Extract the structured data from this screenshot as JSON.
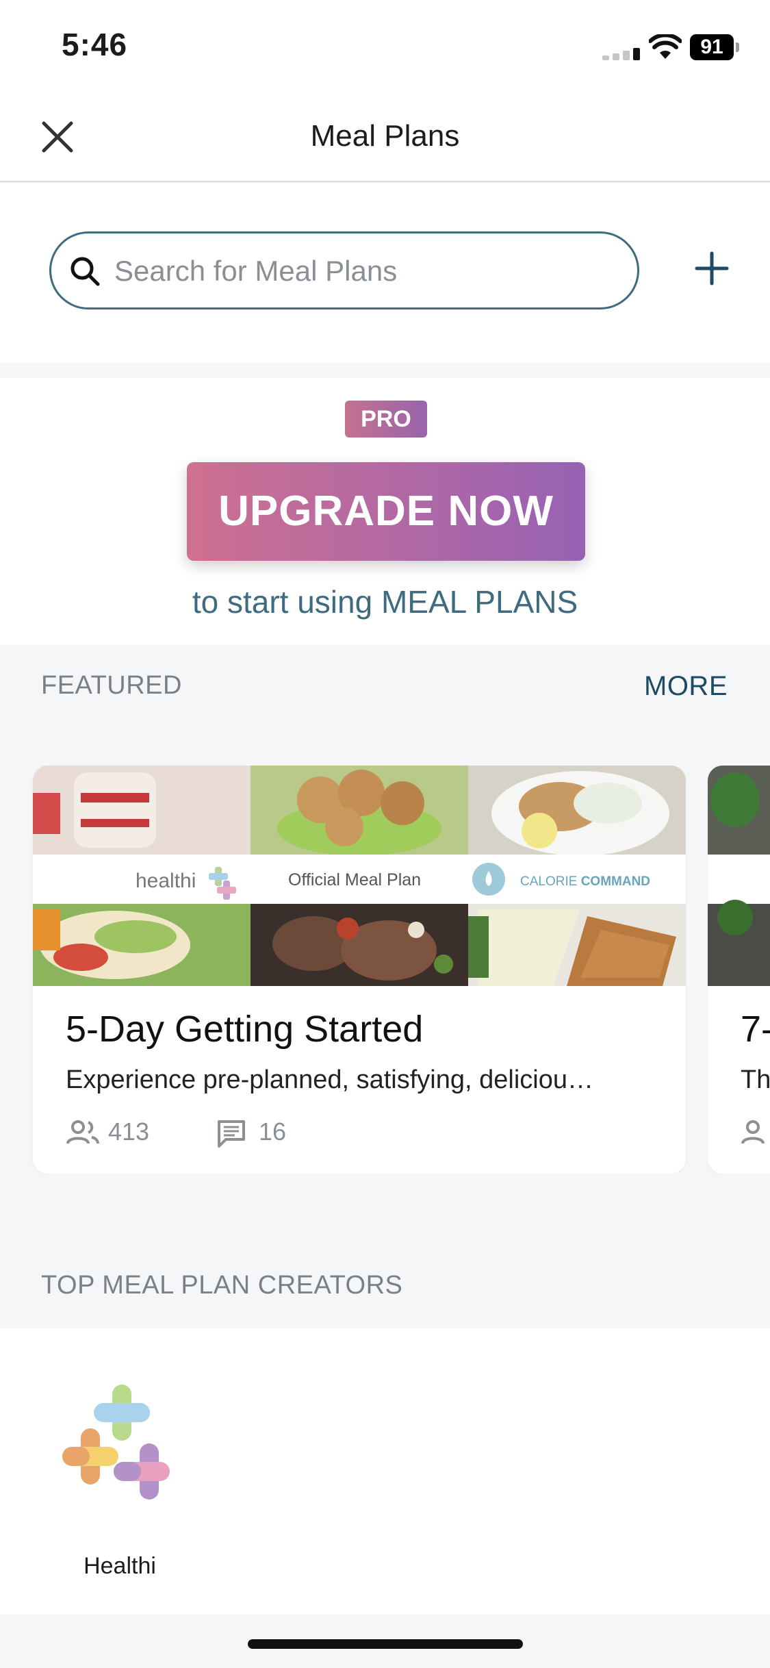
{
  "status_bar": {
    "time": "5:46",
    "battery": "91"
  },
  "nav": {
    "title": "Meal Plans",
    "close_icon": "close-icon"
  },
  "search": {
    "placeholder": "Search for Meal Plans",
    "value": "",
    "add_icon": "plus-icon"
  },
  "upgrade": {
    "badge": "PRO",
    "button_label": "UPGRADE NOW",
    "subtitle": "to start using MEAL PLANS"
  },
  "featured": {
    "label": "FEATURED",
    "more_label": "MORE",
    "cards": [
      {
        "title": "5-Day Getting Started",
        "description": "Experience pre-planned, satisfying, deliciou…",
        "followers": "413",
        "comments": "16",
        "banner_brand": "healthi",
        "banner_label": "Official Meal Plan",
        "banner_partner": "CALORIE",
        "banner_partner_bold": "COMMAND"
      },
      {
        "title": "7-",
        "description": "Th"
      }
    ]
  },
  "creators": {
    "label": "TOP MEAL PLAN CREATORS",
    "items": [
      {
        "name": "Healthi"
      }
    ]
  },
  "colors": {
    "accent": "#3e6b80",
    "pro_gradient_start": "#cf7091",
    "pro_gradient_end": "#9762b4",
    "link": "#1f4a63"
  }
}
